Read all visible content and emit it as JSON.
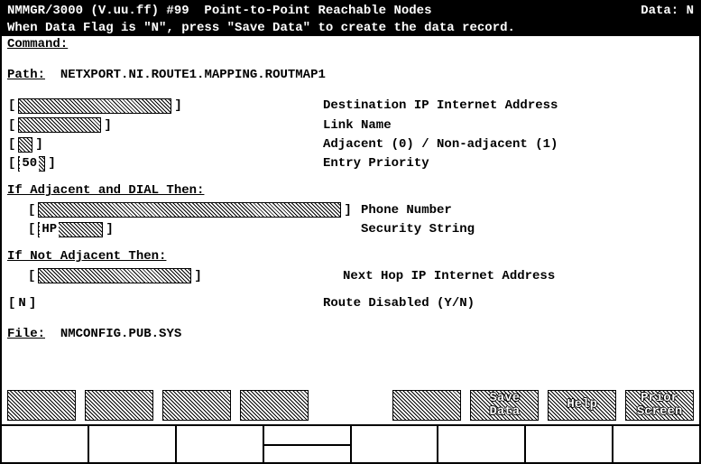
{
  "title_left": "NMMGR/3000 (V.uu.ff) #99  Point-to-Point Reachable Nodes",
  "title_right": "Data: N",
  "hint": "When Data Flag is \"N\", press \"Save Data\" to create the data record.",
  "command_label": "Command:",
  "path_label": "Path:",
  "path_value": "NETXPORT.NI.ROUTE1.MAPPING.ROUTMAP1",
  "fields": {
    "dest_ip": {
      "value": "",
      "label": "Destination IP Internet Address"
    },
    "link_name": {
      "value": "",
      "label": "Link Name"
    },
    "adjacent": {
      "value": "",
      "label": "Adjacent (0) / Non-adjacent (1)"
    },
    "priority": {
      "value": "50",
      "label": "Entry Priority"
    },
    "phone": {
      "value": "",
      "label": "Phone Number"
    },
    "security": {
      "value": "HP",
      "label": "Security String"
    },
    "next_hop": {
      "value": "",
      "label": "Next Hop IP Internet Address"
    },
    "disabled": {
      "value": "N",
      "label": "Route Disabled  (Y/N)"
    }
  },
  "section_adj": "If Adjacent and DIAL Then:",
  "section_notadj": "If Not Adjacent Then:",
  "file_label": "File:",
  "file_value": "NMCONFIG.PUB.SYS",
  "softkeys": {
    "f1": "",
    "f2": "",
    "f3": "",
    "f4": "",
    "f5": "",
    "f6_a": "Save",
    "f6_b": "Data",
    "f7": "Help",
    "f8_a": "Prior",
    "f8_b": "Screen"
  }
}
